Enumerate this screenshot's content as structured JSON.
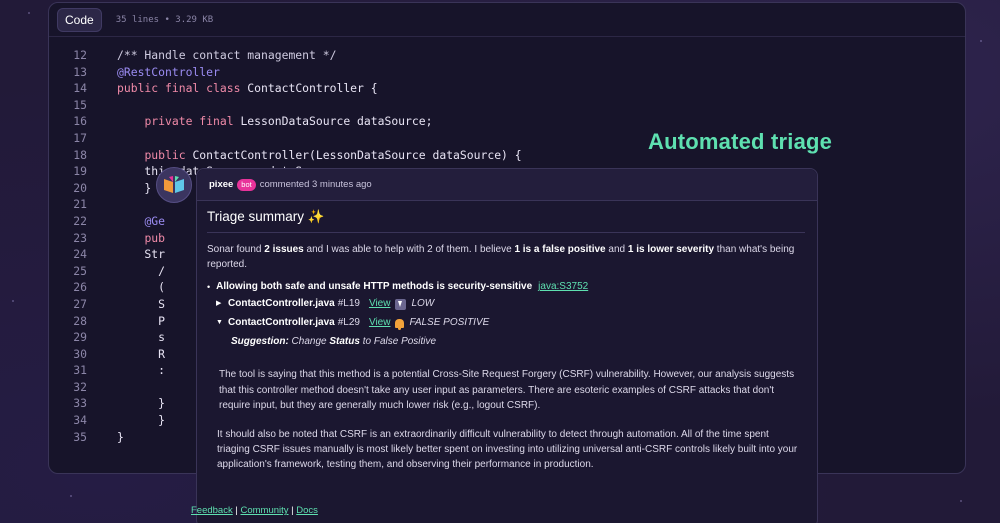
{
  "code_window": {
    "tab_label": "Code",
    "meta": "35 lines • 3.29 KB",
    "lines": [
      {
        "num": "12",
        "parts": [
          {
            "t": "/** Handle contact management */",
            "c": "cm"
          }
        ]
      },
      {
        "num": "13",
        "parts": [
          {
            "t": "@RestController",
            "c": "ann"
          }
        ]
      },
      {
        "num": "14",
        "parts": [
          {
            "t": "public final class",
            "c": "kw"
          },
          {
            "t": " ContactController {",
            "c": ""
          }
        ]
      },
      {
        "num": "15",
        "parts": []
      },
      {
        "num": "16",
        "parts": [
          {
            "t": "    ",
            "c": ""
          },
          {
            "t": "private final",
            "c": "kw"
          },
          {
            "t": " LessonDataSource dataSource;",
            "c": ""
          }
        ]
      },
      {
        "num": "17",
        "parts": []
      },
      {
        "num": "18",
        "parts": [
          {
            "t": "    ",
            "c": ""
          },
          {
            "t": "public",
            "c": "kw"
          },
          {
            "t": " ContactController(LessonDataSource dataSource) {",
            "c": ""
          }
        ]
      },
      {
        "num": "19",
        "parts": [
          {
            "t": "    this.dataSource = dataSource;",
            "c": ""
          }
        ]
      },
      {
        "num": "20",
        "parts": [
          {
            "t": "    }",
            "c": ""
          }
        ]
      },
      {
        "num": "21",
        "parts": []
      },
      {
        "num": "22",
        "parts": [
          {
            "t": "    ",
            "c": ""
          },
          {
            "t": "@Ge",
            "c": "ann"
          }
        ]
      },
      {
        "num": "23",
        "parts": [
          {
            "t": "    ",
            "c": ""
          },
          {
            "t": "pub",
            "c": "kw"
          }
        ]
      },
      {
        "num": "24",
        "parts": [
          {
            "t": "    Str",
            "c": ""
          }
        ]
      },
      {
        "num": "25",
        "parts": [
          {
            "t": "      /",
            "c": ""
          }
        ]
      },
      {
        "num": "26",
        "parts": [
          {
            "t": "      (",
            "c": ""
          }
        ]
      },
      {
        "num": "27",
        "parts": [
          {
            "t": "      S",
            "c": ""
          }
        ]
      },
      {
        "num": "28",
        "parts": [
          {
            "t": "      P",
            "c": ""
          }
        ]
      },
      {
        "num": "29",
        "parts": [
          {
            "t": "      s",
            "c": ""
          }
        ]
      },
      {
        "num": "30",
        "parts": [
          {
            "t": "      R",
            "c": ""
          }
        ]
      },
      {
        "num": "31",
        "parts": [
          {
            "t": "      :",
            "c": ""
          }
        ]
      },
      {
        "num": "32",
        "parts": []
      },
      {
        "num": "33",
        "parts": [
          {
            "t": "      }",
            "c": ""
          }
        ]
      },
      {
        "num": "34",
        "parts": [
          {
            "t": "      }",
            "c": ""
          }
        ]
      },
      {
        "num": "35",
        "parts": [
          {
            "t": "}",
            "c": ""
          }
        ]
      }
    ]
  },
  "title": "Automated triage",
  "comment": {
    "author": "pixee",
    "badge": "bot",
    "action": "commented 3 minutes ago",
    "heading": "Triage summary",
    "heading_emoji": "✨",
    "intro": {
      "t1": "Sonar found ",
      "b1": "2 issues",
      "t2": " and I was able to help with 2 of them. I believe ",
      "b2": "1 is a false positive",
      "t3": " and ",
      "b3": "1 is lower severity",
      "t4": " than what's being reported."
    },
    "issue": {
      "bullet": "•",
      "title": "Allowing both safe and unsafe HTTP methods is security-sensitive",
      "rule": "java:S3752"
    },
    "findings": [
      {
        "arrow": "▶",
        "file": "ContactController.java",
        "line": "#L19",
        "view": "View",
        "status": "LOW",
        "icon": "down-arrow-icon"
      },
      {
        "arrow": "▼",
        "file": "ContactController.java",
        "line": "#L29",
        "view": "View",
        "status": "FALSE POSITIVE",
        "icon": "bell-icon"
      }
    ],
    "suggestion": {
      "label": "Suggestion:",
      "t1": " Change ",
      "b1": "Status",
      "t2": " to False Positive"
    },
    "paragraph1": "The tool is saying that this method is a potential Cross-Site Request Forgery (CSRF) vulnerability. However, our analysis suggests that this controller method doesn't take any user input as parameters. There are esoteric examples of CSRF attacks that don't require input, but they are generally much lower risk (e.g., logout CSRF).",
    "paragraph2": "It should also be noted that CSRF is an extraordinarily difficult vulnerability to detect through automation. All of the time spent triaging CSRF issues manually is most likely better spent on investing into utilizing universal anti-CSRF controls likely built into your application's framework, testing them, and observing their performance in production."
  },
  "footer": {
    "feedback": "Feedback",
    "community": "Community",
    "docs": "Docs",
    "sep": "|"
  },
  "colors": {
    "background": "#221a38",
    "accent_green": "#5ee0b0",
    "bot_badge": "#e8339a",
    "keyword": "#f08aa8",
    "annotation": "#9b8cf2"
  }
}
